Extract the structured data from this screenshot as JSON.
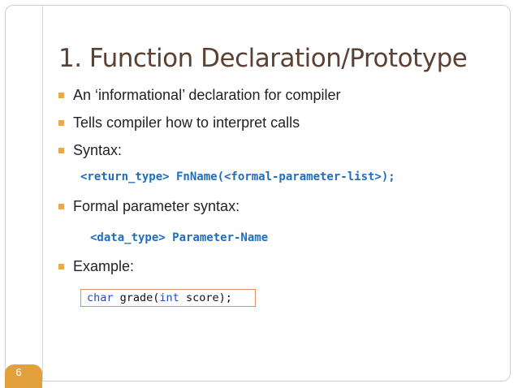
{
  "slide": {
    "title": "1. Function Declaration/Prototype",
    "bullets": [
      "An ‘informational’ declaration for compiler",
      "Tells compiler how to interpret calls",
      "Syntax:",
      "Formal parameter syntax:",
      "Example:"
    ],
    "syntax_code": "<return_type> FnName(<formal-parameter-list>);",
    "param_code": "<data_type> Parameter-Name",
    "example": {
      "kw1": "char",
      "part1": " grade(",
      "kw2": "int",
      "part2": " score);"
    },
    "page_number": "6"
  },
  "colors": {
    "title": "#5a4133",
    "bullet_marker": "#e8a94a",
    "code": "#1e6ebf",
    "page_badge": "#e1a03c",
    "example_border": "#e28c6a"
  }
}
